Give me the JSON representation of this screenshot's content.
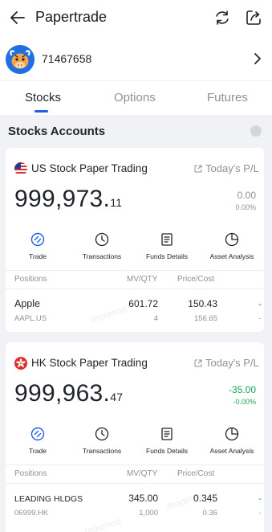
{
  "header": {
    "title": "Papertrade"
  },
  "account": {
    "id": "71467658"
  },
  "tabs": [
    {
      "label": "Stocks",
      "active": true
    },
    {
      "label": "Options",
      "active": false
    },
    {
      "label": "Futures",
      "active": false
    }
  ],
  "section": {
    "title": "Stocks Accounts"
  },
  "colors": {
    "accent": "#1f5fe6",
    "positive": "#1aa35a",
    "muted": "#8d9199"
  },
  "watermark": "moomoo",
  "accounts": [
    {
      "name": "US Stock Paper Trading",
      "flag": "us-flag-icon",
      "pl_label": "Today's P/L",
      "value_int": "999,973.",
      "value_dec": "11",
      "pl_value": "0.00",
      "pl_pct": "0.00%",
      "actions": [
        {
          "label": "Trade",
          "icon": "trade-icon"
        },
        {
          "label": "Transactions",
          "icon": "clock-icon"
        },
        {
          "label": "Funds Details",
          "icon": "document-icon"
        },
        {
          "label": "Asset Analysis",
          "icon": "pie-chart-icon"
        }
      ],
      "columns": {
        "positions": "Positions",
        "mv_qty": "MV/QTY",
        "price_cost": "Price/Cost"
      },
      "position": {
        "name": "Apple",
        "code": "AAPL.US",
        "mv": "601.72",
        "qty": "4",
        "price": "150.43",
        "cost": "156.65",
        "pl_partial": "-",
        "pl_partial2": "-"
      }
    },
    {
      "name": "HK Stock Paper Trading",
      "flag": "hk-flag-icon",
      "pl_label": "Today's P/L",
      "value_int": "999,963.",
      "value_dec": "47",
      "pl_value": "-35.00",
      "pl_pct": "-0.00%",
      "actions": [
        {
          "label": "Trade",
          "icon": "trade-icon"
        },
        {
          "label": "Transactions",
          "icon": "clock-icon"
        },
        {
          "label": "Funds Details",
          "icon": "document-icon"
        },
        {
          "label": "Asset Analysis",
          "icon": "pie-chart-icon"
        }
      ],
      "columns": {
        "positions": "Positions",
        "mv_qty": "MV/QTY",
        "price_cost": "Price/Cost"
      },
      "position": {
        "name": "LEADING HLDGS",
        "code": "06999.HK",
        "mv": "345.00",
        "qty": "1,000",
        "price": "0.345",
        "cost": "0.36",
        "pl_partial": "-",
        "pl_partial2": "-"
      }
    }
  ]
}
